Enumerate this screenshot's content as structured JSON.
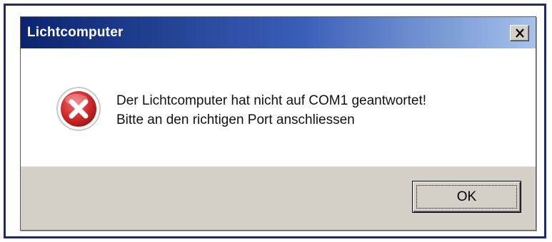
{
  "dialog": {
    "title": "Lichtcomputer",
    "close_icon": "close-icon",
    "icon": "error-icon",
    "message_line1": "Der Lichtcomputer hat nicht auf COM1 geantwortet!",
    "message_line2": "Bitte an den richtigen Port anschliessen",
    "ok_label": "OK"
  },
  "colors": {
    "title_gradient_start": "#0b2470",
    "title_gradient_end": "#a6c2ea",
    "error_red": "#d12a2a",
    "face": "#d4d0c8",
    "frame": "#1e2a6e"
  }
}
